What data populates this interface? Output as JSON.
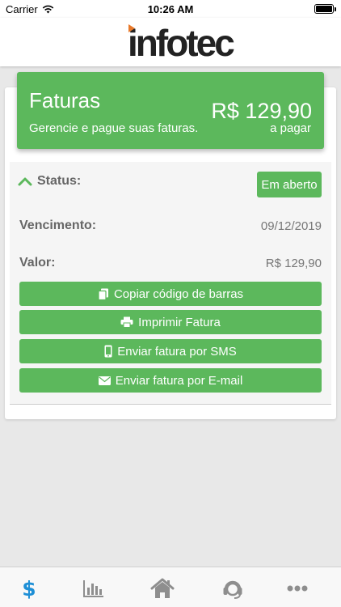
{
  "statusbar": {
    "carrier": "Carrier",
    "time": "10:26 AM"
  },
  "header": {
    "logo_text": "infotec"
  },
  "invoice": {
    "title": "Faturas",
    "subtitle": "Gerencie e pague suas faturas.",
    "amount": "R$ 129,90",
    "amount_caption": "a pagar",
    "status_label": "Status:",
    "status_value": "Em aberto",
    "due_label": "Vencimento:",
    "due_value": "09/12/2019",
    "value_label": "Valor:",
    "value_value": "R$ 129,90"
  },
  "actions": [
    {
      "label": "Copiar código de barras",
      "icon": "copy-icon"
    },
    {
      "label": "Imprimir Fatura",
      "icon": "printer-icon"
    },
    {
      "label": "Enviar fatura por SMS",
      "icon": "mobile-icon"
    },
    {
      "label": "Enviar fatura por E-mail",
      "icon": "envelope-icon"
    }
  ],
  "tabs": [
    {
      "icon": "dollar-icon",
      "active": true
    },
    {
      "icon": "bar-chart-icon",
      "active": false
    },
    {
      "icon": "home-icon",
      "active": false
    },
    {
      "icon": "support-headset-icon",
      "active": false
    },
    {
      "icon": "more-icon",
      "active": false
    }
  ],
  "colors": {
    "primary_green": "#5cb85c",
    "active_tab": "#1e8fd6",
    "inactive_tab": "#8e8e8e",
    "logo_accent": "#e8792a"
  }
}
